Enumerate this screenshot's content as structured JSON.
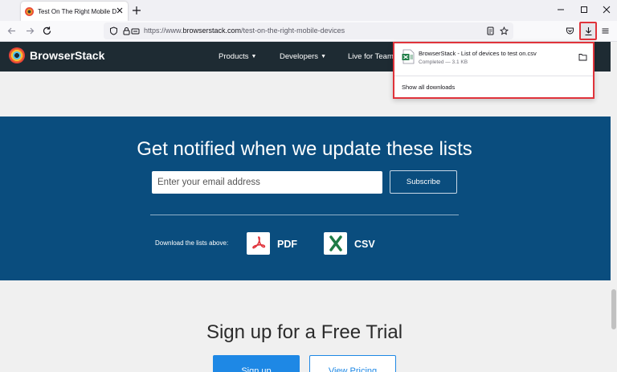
{
  "browser": {
    "tab_title": "Test On The Right Mobile Device",
    "url_scheme": "https://www.",
    "url_host": "browserstack.com",
    "url_path": "/test-on-the-right-mobile-devices"
  },
  "site": {
    "brand": "BrowserStack",
    "nav": [
      {
        "label": "Products"
      },
      {
        "label": "Developers"
      },
      {
        "label": "Live for Teams"
      }
    ]
  },
  "notify": {
    "title": "Get notified when we update these lists",
    "email_placeholder": "Enter your email address",
    "subscribe_label": "Subscribe",
    "download_label": "Download the lists above:",
    "pdf_label": "PDF",
    "csv_label": "CSV"
  },
  "signup": {
    "title": "Sign up for a Free Trial",
    "signup_label": "Sign up",
    "pricing_label": "View Pricing"
  },
  "downloads_panel": {
    "file_name": "BrowserStack - List of devices to test on.csv",
    "status": "Completed — 3.1 KB",
    "show_all": "Show all downloads"
  },
  "colors": {
    "header_bg": "#1e2b33",
    "band_bg": "#0a4d7e",
    "accent_blue": "#1e88e5",
    "highlight_red": "#e0333b"
  }
}
